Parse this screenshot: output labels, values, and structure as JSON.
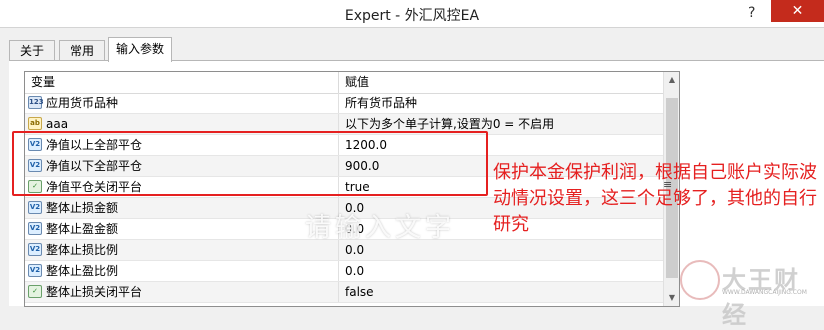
{
  "window": {
    "title": "Expert - 外汇风控EA",
    "help_label": "?",
    "close_label": "✕"
  },
  "tabs": [
    {
      "label": "关于",
      "active": false
    },
    {
      "label": "常用",
      "active": false
    },
    {
      "label": "输入参数",
      "active": true
    }
  ],
  "table": {
    "headers": {
      "variable": "变量",
      "value": "赋值"
    },
    "rows": [
      {
        "icon": "number-type-icon",
        "icon_text": "123",
        "name": "应用货币品种",
        "value": "所有货币品种"
      },
      {
        "icon": "string-type-icon",
        "icon_text": "ab",
        "name": "aaa",
        "value": "以下为多个单子计算,设置为0 = 不启用"
      },
      {
        "icon": "double-type-icon",
        "icon_text": "V2",
        "name": "净值以上全部平仓",
        "value": "1200.0"
      },
      {
        "icon": "double-type-icon",
        "icon_text": "V2",
        "name": "净值以下全部平仓",
        "value": "900.0"
      },
      {
        "icon": "bool-type-icon",
        "icon_text": "✓",
        "name": "净值平仓关闭平台",
        "value": "true"
      },
      {
        "icon": "double-type-icon",
        "icon_text": "V2",
        "name": "整体止损金额",
        "value": "0.0"
      },
      {
        "icon": "double-type-icon",
        "icon_text": "V2",
        "name": "整体止盈金额",
        "value": "0.0"
      },
      {
        "icon": "double-type-icon",
        "icon_text": "V2",
        "name": "整体止损比例",
        "value": "0.0"
      },
      {
        "icon": "double-type-icon",
        "icon_text": "V2",
        "name": "整体止盈比例",
        "value": "0.0"
      },
      {
        "icon": "bool-type-icon",
        "icon_text": "✓",
        "name": "整体止损关闭平台",
        "value": "false"
      }
    ]
  },
  "annotation": {
    "text": "保护本金保护利润，根据自己账户实际波动情况设置，这三个足够了，其他的自行研究",
    "color": "#e52020"
  },
  "watermark": {
    "text": "请输入文字",
    "logo_text": "大王财经",
    "logo_url": "WWW.DAWANGCAIJING.COM"
  }
}
